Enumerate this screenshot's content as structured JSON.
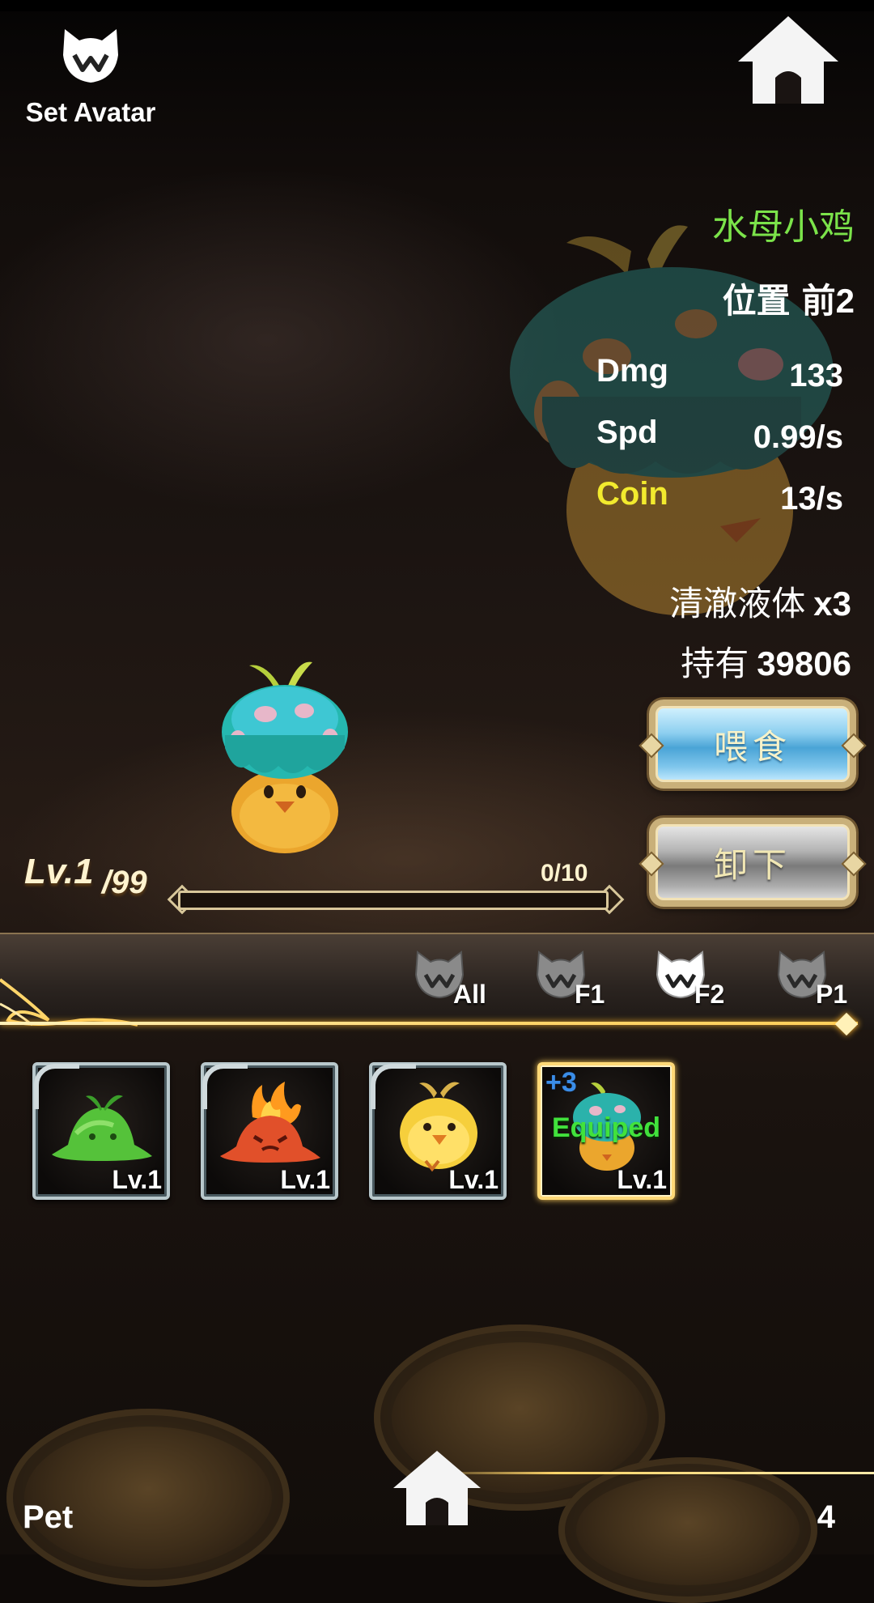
{
  "header": {
    "avatar_label": "Set Avatar",
    "avatar_icon": "cat-mask-icon",
    "home_icon": "home-icon"
  },
  "pet_info": {
    "name": "水母小鸡",
    "name_color": "#7be34a",
    "position_label": "位置",
    "position_value": "前2",
    "stats": [
      {
        "label": "Dmg",
        "value": "133"
      },
      {
        "label": "Spd",
        "value": "0.99/s"
      },
      {
        "label": "Coin",
        "value": "13/s",
        "color": "#f2ea2e"
      }
    ],
    "food_name": "清澈液体",
    "food_qty": "x3",
    "hold_label": "持有",
    "hold_value": "39806",
    "feed_button": "喂食",
    "unequip_button": "卸下"
  },
  "level": {
    "current": "Lv.1",
    "max": "/99",
    "exp_text": "0/10",
    "exp_fraction": 0
  },
  "filter_tabs": [
    {
      "label": "All",
      "active": false
    },
    {
      "label": "F1",
      "active": false
    },
    {
      "label": "F2",
      "active": true
    },
    {
      "label": "P1",
      "active": false
    }
  ],
  "slots": [
    {
      "pet": "green-slime",
      "level": "Lv.1",
      "selected": false
    },
    {
      "pet": "fire-slime",
      "level": "Lv.1",
      "selected": false
    },
    {
      "pet": "yellow-chick",
      "level": "Lv.1",
      "selected": false
    },
    {
      "pet": "jellyfish-chick",
      "level": "Lv.1",
      "selected": true,
      "plus": "+3",
      "status": "Equiped"
    }
  ],
  "footer": {
    "section_label": "Pet",
    "count": "4"
  }
}
